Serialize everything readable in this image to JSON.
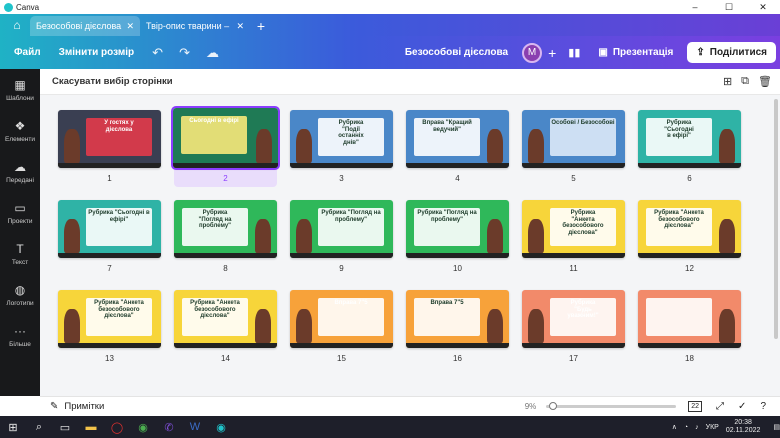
{
  "app": {
    "title": "Canva"
  },
  "window_controls": [
    "–",
    "☐",
    "✕"
  ],
  "tabs": [
    {
      "label": "Безособові дієслова ...",
      "active": true
    },
    {
      "label": "Твір-опис тварини – ...",
      "active": false
    }
  ],
  "toolbar": {
    "file_label": "Файл",
    "resize_label": "Змінити розмір",
    "doc_title": "Безособові дієслова",
    "avatar_letter": "M",
    "present_label": "Презентація",
    "share_label": "Поділитися"
  },
  "sidebar": {
    "items": [
      {
        "label": "Шаблони",
        "icon": "templates-icon"
      },
      {
        "label": "Елементи",
        "icon": "elements-icon"
      },
      {
        "label": "Передані",
        "icon": "uploads-icon"
      },
      {
        "label": "Проекти",
        "icon": "projects-icon"
      },
      {
        "label": "Текст",
        "icon": "text-icon"
      },
      {
        "label": "Логотипи",
        "icon": "logos-icon"
      },
      {
        "label": "Більше",
        "icon": "more-icon"
      }
    ]
  },
  "content": {
    "cancel_selection": "Скасувати вибір сторінки"
  },
  "pages": [
    {
      "num": "1",
      "title": "У гостях у\nдієслова",
      "bg": "#3a3f52",
      "accent": "#e33a4a",
      "text_color": "#ffffff"
    },
    {
      "num": "2",
      "title": "Сьогодні в ефірі",
      "bg": "#1f7a55",
      "accent": "#f7e87a",
      "text_color": "#ffffff",
      "selected": true
    },
    {
      "num": "3",
      "title": "Рубрика\n\"Події\nостанніх\nднів\"",
      "bg": "#4a87c8",
      "accent": "#ffffff",
      "text_color": "#1d3b2a"
    },
    {
      "num": "4",
      "title": "Вправа \"Кращий ведучий\"",
      "bg": "#4a87c8",
      "accent": "#ffffff",
      "text_color": "#1d3b2a"
    },
    {
      "num": "5",
      "title": "Особові / Безособові",
      "bg": "#4a87c8",
      "accent": "#dbe9f7",
      "text_color": "#1d3b2a"
    },
    {
      "num": "6",
      "title": "Рубрика\n\"Сьогодні\nв ефірі\"",
      "bg": "#2fb3a6",
      "accent": "#ffffff",
      "text_color": "#1d3b2a"
    },
    {
      "num": "7",
      "title": "Рубрика \"Сьогодні в ефірі\"",
      "bg": "#2fb3a6",
      "accent": "#ffffff",
      "text_color": "#1d3b2a"
    },
    {
      "num": "8",
      "title": "Рубрика\n\"Погляд на\nпроблему\"",
      "bg": "#2fb85a",
      "accent": "#ffffff",
      "text_color": "#1d3b2a"
    },
    {
      "num": "9",
      "title": "Рубрика \"Погляд на проблему\"",
      "bg": "#2fb85a",
      "accent": "#ffffff",
      "text_color": "#1d3b2a"
    },
    {
      "num": "10",
      "title": "Рубрика \"Погляд на проблему\"",
      "bg": "#2fb85a",
      "accent": "#ffffff",
      "text_color": "#1d3b2a"
    },
    {
      "num": "11",
      "title": "Рубрика\n\"Анкета\nбезособового\nдієслова\"",
      "bg": "#f7d53a",
      "accent": "#ffffff",
      "text_color": "#1d3b2a"
    },
    {
      "num": "12",
      "title": "Рубрика \"Анкета безособового\nдієслова\"",
      "bg": "#f7d53a",
      "accent": "#ffffff",
      "text_color": "#1d3b2a"
    },
    {
      "num": "13",
      "title": "Рубрика \"Анкета\nбезособового дієслова\"",
      "bg": "#f7d53a",
      "accent": "#ffffff",
      "text_color": "#1d3b2a"
    },
    {
      "num": "14",
      "title": "Рубрика \"Анкета безособового\nдієслова\"",
      "bg": "#f7d53a",
      "accent": "#ffffff",
      "text_color": "#1d3b2a"
    },
    {
      "num": "15",
      "title": "Вправа 7\"5",
      "bg": "#f7a23a",
      "accent": "#ffffff",
      "text_color": "#ffffff"
    },
    {
      "num": "16",
      "title": "Вправа 7\"5",
      "bg": "#f7a23a",
      "accent": "#ffffff",
      "text_color": "#1d3b2a"
    },
    {
      "num": "17",
      "title": "Рубрика\n\"Будь\nуважним!\"",
      "bg": "#f28a6a",
      "accent": "#ffffff",
      "text_color": "#ffffff"
    },
    {
      "num": "18",
      "title": "",
      "bg": "#f28a6a",
      "accent": "#ffffff",
      "text_color": "#1d3b2a"
    }
  ],
  "bottom": {
    "notes_label": "Примітки",
    "zoom": "9%",
    "zoom_fraction": 0.02,
    "page_count": "22"
  },
  "taskbar": {
    "lang": "УКР",
    "time": "20:38",
    "date": "02.11.2022"
  }
}
